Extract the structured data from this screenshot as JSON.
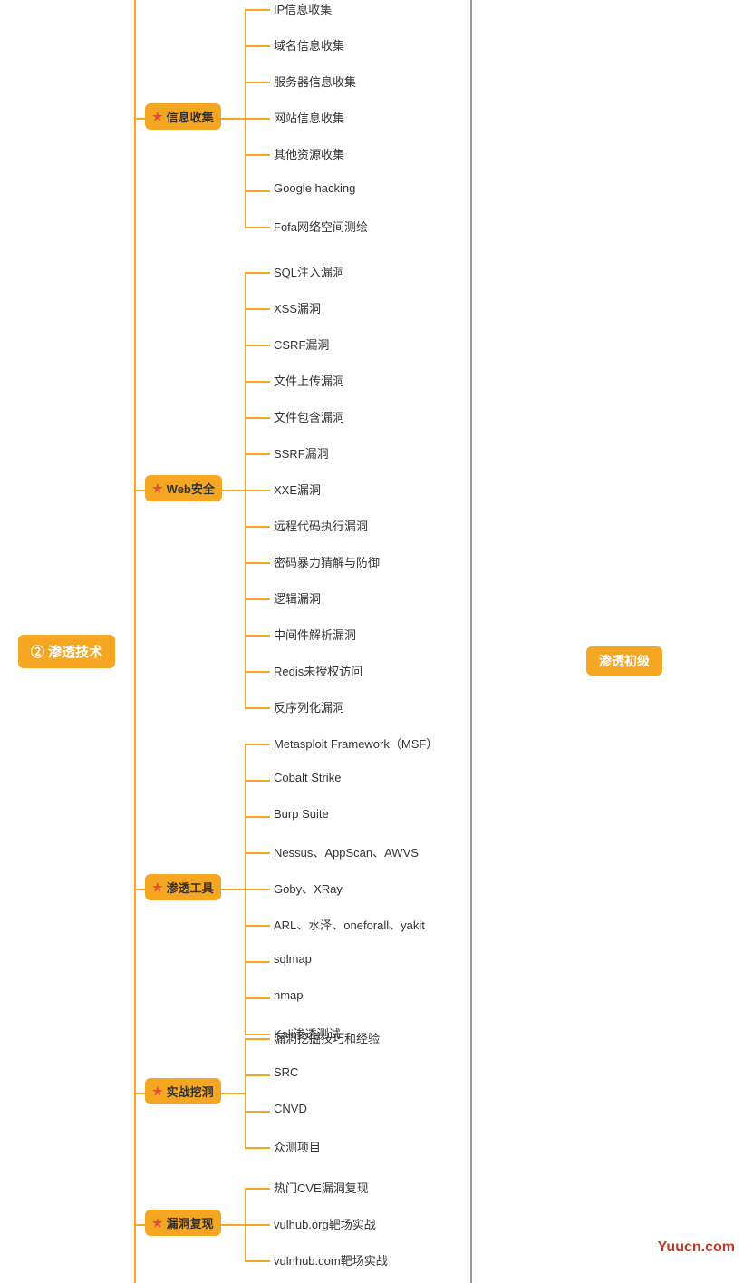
{
  "root": {
    "label": "② 渗透技术"
  },
  "highlight": "渗透初级",
  "watermark": "Yuucn.com",
  "branches": [
    {
      "id": "info-collect",
      "label": "信息收集",
      "centerY": 130,
      "items": [
        "IP信息收集",
        "域名信息收集",
        "服务器信息收集",
        "网站信息收集",
        "其他资源收集",
        "Google hacking",
        "Fofa网络空间测绘"
      ]
    },
    {
      "id": "web-security",
      "label": "Web安全",
      "centerY": 540,
      "items": [
        "SQL注入漏洞",
        "XSS漏洞",
        "CSRF漏洞",
        "文件上传漏洞",
        "文件包含漏洞",
        "SSRF漏洞",
        "XXE漏洞",
        "远程代码执行漏洞",
        "密码暴力猜解与防御",
        "逻辑漏洞",
        "中间件解析漏洞",
        "Redis未授权访问",
        "反序列化漏洞"
      ]
    },
    {
      "id": "pentest-tools",
      "label": "渗透工具",
      "centerY": 980,
      "items": [
        "Metasploit Framework（MSF）",
        "Cobalt Strike",
        "Burp Suite",
        "Nessus、AppScan、AWVS",
        "Goby、XRay",
        "ARL、水泽、oneforall、yakit",
        "sqlmap",
        "nmap",
        "Kali渗透测试"
      ]
    },
    {
      "id": "practice-mining",
      "label": "实战挖洞",
      "centerY": 1205,
      "items": [
        "漏洞挖掘技巧和经验",
        "SRC",
        "CNVD",
        "众测项目"
      ]
    },
    {
      "id": "vuln-reproduce",
      "label": "漏洞复现",
      "centerY": 1350,
      "items": [
        "热门CVE漏洞复现",
        "vulhub.org靶场实战",
        "vulnhub.com靶场实战"
      ]
    }
  ]
}
